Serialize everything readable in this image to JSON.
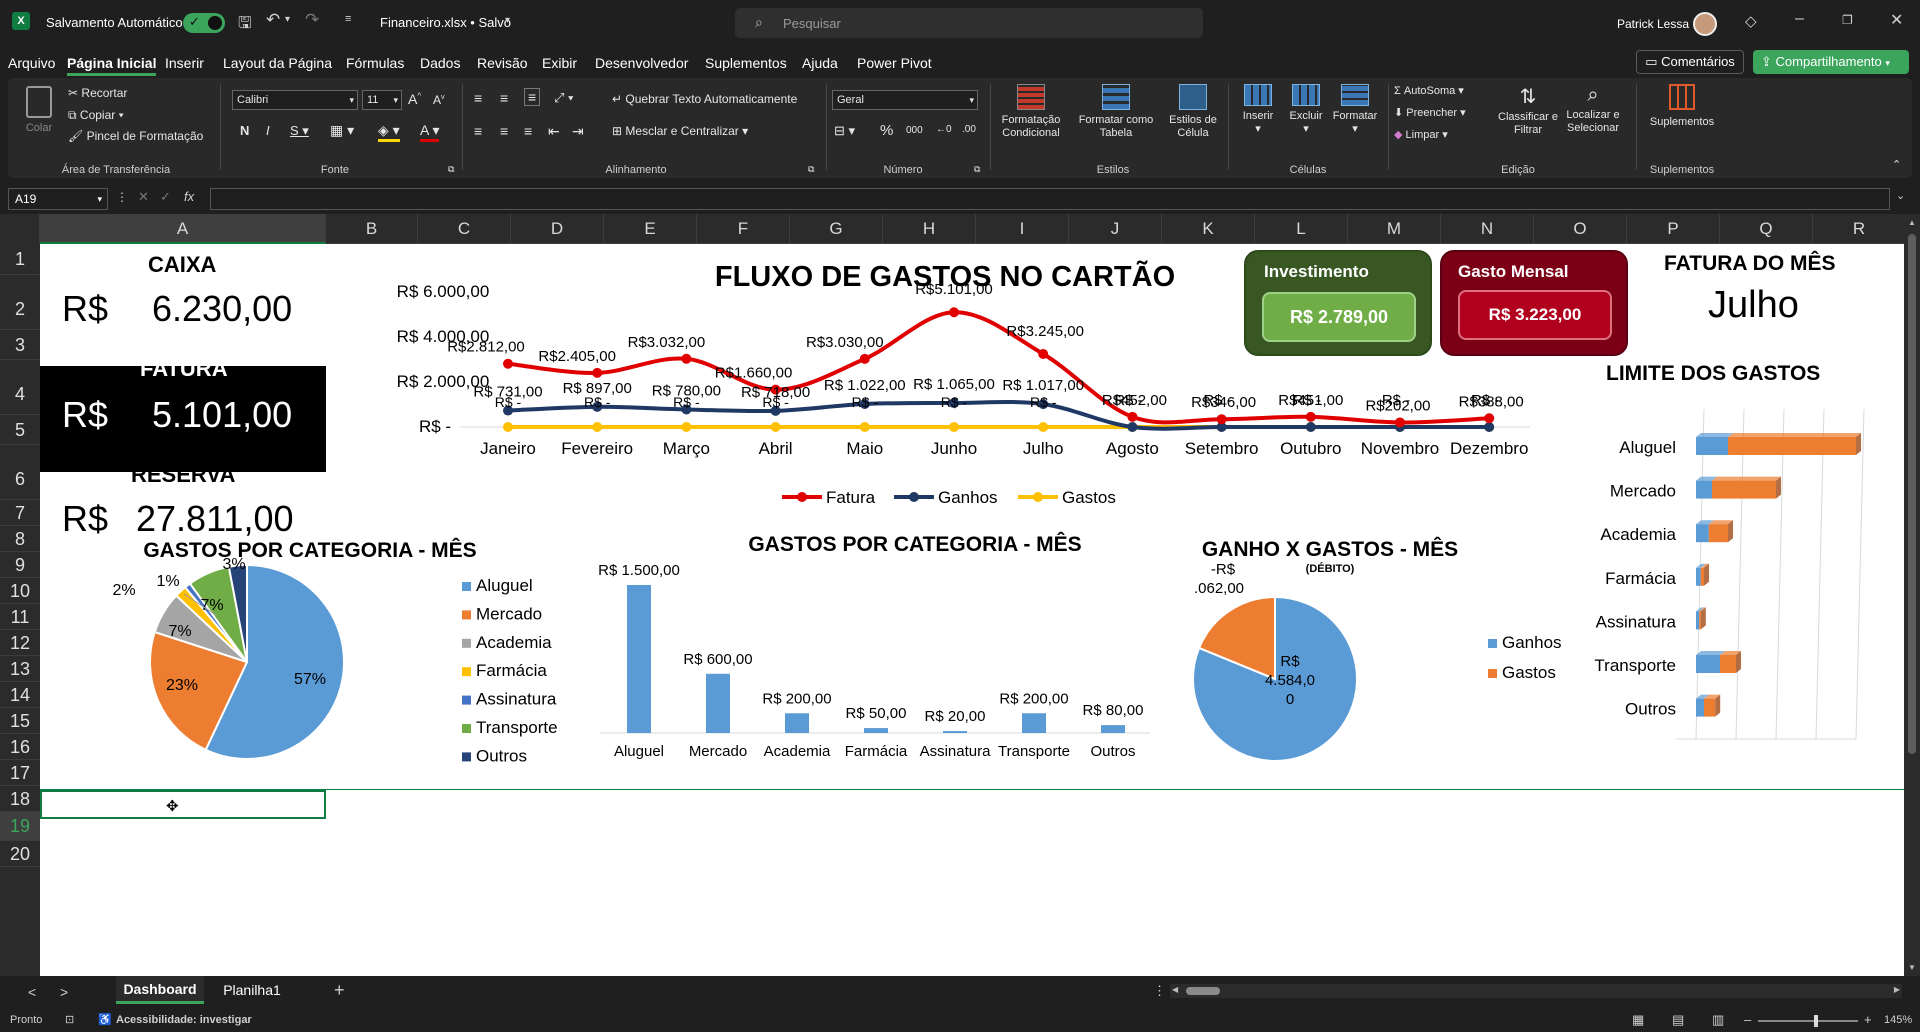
{
  "titlebar": {
    "autosave_label": "Salvamento Automático",
    "filename": "Financeiro.xlsx • Salvo",
    "search_placeholder": "Pesquisar",
    "user": "Patrick Lessa"
  },
  "menu": [
    "Arquivo",
    "Página Inicial",
    "Inserir",
    "Layout da Página",
    "Fórmulas",
    "Dados",
    "Revisão",
    "Exibir",
    "Desenvolvedor",
    "Suplementos",
    "Ajuda",
    "Power Pivot"
  ],
  "menu_right": {
    "comments": "Comentários",
    "share": "Compartilhamento"
  },
  "ribbon": {
    "clipboard": {
      "paste": "Colar",
      "cut": "Recortar",
      "copy": "Copiar",
      "format_painter": "Pincel de Formatação",
      "label": "Área de Transferência"
    },
    "font": {
      "name": "Calibri",
      "size": "11",
      "label": "Fonte"
    },
    "alignment": {
      "wrap": "Quebrar Texto Automaticamente",
      "merge": "Mesclar e Centralizar",
      "label": "Alinhamento"
    },
    "number": {
      "format": "Geral",
      "label": "Número"
    },
    "styles": {
      "cond": "Formatação Condicional",
      "table": "Formatar como Tabela",
      "cell": "Estilos de Célula",
      "label": "Estilos"
    },
    "cells": {
      "insert": "Inserir",
      "delete": "Excluir",
      "format": "Formatar",
      "label": "Células"
    },
    "editing": {
      "autosum": "AutoSoma",
      "fill": "Preencher",
      "clear": "Limpar",
      "sort": "Classificar e Filtrar",
      "find": "Localizar e Selecionar",
      "label": "Edição"
    },
    "addins": {
      "addins": "Suplementos",
      "label": "Suplementos"
    }
  },
  "formula": {
    "namebox": "A19",
    "fx": "fx"
  },
  "columns": [
    "A",
    "B",
    "C",
    "D",
    "E",
    "F",
    "G",
    "H",
    "I",
    "J",
    "K",
    "L",
    "M",
    "N",
    "O",
    "P",
    "Q",
    "R"
  ],
  "rows": [
    "1",
    "2",
    "3",
    "4",
    "5",
    "6",
    "7",
    "8",
    "9",
    "10",
    "11",
    "12",
    "13",
    "14",
    "15",
    "16",
    "17",
    "18",
    "19",
    "20"
  ],
  "dashboard": {
    "caixa_title": "CAIXA",
    "caixa_cur": "R$",
    "caixa_val": "6.230,00",
    "fatura_title": "FATURA",
    "fatura_cur": "R$",
    "fatura_val": "5.101,00",
    "reserva_title": "RESERVA",
    "reserva_cur": "R$",
    "reserva_val": "27.811,00",
    "investimento_title": "Investimento",
    "investimento_val": "R$ 2.789,00",
    "gasto_title": "Gasto Mensal",
    "gasto_val": "R$ 3.223,00",
    "fatura_mes_title": "FATURA DO MÊS",
    "fatura_mes_val": "Julho",
    "limite_title": "LIMITE DOS GASTOS",
    "ganho_title": "GANHO X GASTOS - MÊS",
    "ganho_sub": "(DÉBITO)",
    "colors": {
      "green_dark": "#385723",
      "green_light": "#70ad47",
      "red_dark": "#7b0016",
      "red_light": "#c00000"
    }
  },
  "chart_data": [
    {
      "type": "line",
      "title": "FLUXO DE GASTOS NO CARTÃO",
      "categories": [
        "Janeiro",
        "Fevereiro",
        "Março",
        "Abril",
        "Maio",
        "Junho",
        "Julho",
        "Agosto",
        "Setembro",
        "Outubro",
        "Novembro",
        "Dezembro"
      ],
      "yticks": [
        "R$ 6.000,00",
        "R$ 4.000,00",
        "R$ 2.000,00",
        "R$ -"
      ],
      "ylim": [
        0,
        6000
      ],
      "series": [
        {
          "name": "Fatura",
          "color": "#e00000",
          "values": [
            2812,
            2405,
            3032,
            1660,
            3030,
            5101,
            3245,
            452,
            346,
            451,
            202,
            388
          ],
          "labels": [
            "R$2.812,00",
            "R$2.405,00",
            "R$3.032,00",
            "R$1.660,00",
            "R$3.030,00",
            "R$5.101,00",
            "R$3.245,00",
            "R$452,00",
            "R$346,00",
            "R$451,00",
            "R$202,00",
            "R$388,00"
          ]
        },
        {
          "name": "Ganhos",
          "color": "#1f3864",
          "values": [
            731,
            897,
            780,
            718,
            1022,
            1065,
            1017,
            0,
            0,
            0,
            0,
            0
          ],
          "labels": [
            "R$ 731,00",
            "R$ 897,00",
            "R$ 780,00",
            "R$ 718,00",
            "R$ 1.022,00",
            "R$ 1.065,00",
            "R$ 1.017,00",
            "R$ -",
            "R$ -",
            "R$ -",
            "R$ -",
            "R$ -"
          ]
        },
        {
          "name": "Gastos",
          "color": "#ffc000",
          "values": [
            0,
            0,
            0,
            0,
            0,
            0,
            0,
            0,
            0,
            0,
            0,
            0
          ],
          "labels": [
            "R$ -",
            "R$ -",
            "R$ -",
            "R$ -",
            "R$ -",
            "R$ -",
            "R$ -",
            "R$ -",
            "R$ -",
            "R$ -",
            "R$ -",
            "R$ -"
          ]
        }
      ],
      "legend": "bottom"
    },
    {
      "type": "pie",
      "title": "GASTOS POR CATEGORIA - MÊS",
      "categories": [
        "Aluguel",
        "Mercado",
        "Academia",
        "Farmácia",
        "Assinatura",
        "Transporte",
        "Outros"
      ],
      "values": [
        57,
        23,
        7,
        2,
        1,
        7,
        3
      ],
      "labels": [
        "57%",
        "23%",
        "7%",
        "2%",
        "1%",
        "7%",
        "3%"
      ],
      "colors": [
        "#5b9bd5",
        "#ed7d31",
        "#a5a5a5",
        "#ffc000",
        "#4472c4",
        "#70ad47",
        "#264478"
      ],
      "legend": "right"
    },
    {
      "type": "bar",
      "title": "GASTOS POR CATEGORIA - MÊS",
      "categories": [
        "Aluguel",
        "Mercado",
        "Academia",
        "Farmácia",
        "Assinatura",
        "Transporte",
        "Outros"
      ],
      "values": [
        1500,
        600,
        200,
        50,
        20,
        200,
        80
      ],
      "labels": [
        "R$ 1.500,00",
        "R$ 600,00",
        "R$ 200,00",
        "R$ 50,00",
        "R$ 20,00",
        "R$ 200,00",
        "R$ 80,00"
      ],
      "color": "#5b9bd5"
    },
    {
      "type": "pie",
      "title": "GANHO X GASTOS - MÊS",
      "categories": [
        "Ganhos",
        "Gastos"
      ],
      "values": [
        4584,
        1062
      ],
      "labels": [
        "R$ 4.584,0 0",
        "-R$ .062,00"
      ],
      "colors": [
        "#5b9bd5",
        "#ed7d31"
      ],
      "legend": "right"
    },
    {
      "type": "bar",
      "title": "LIMITE DOS GASTOS",
      "orientation": "horizontal",
      "categories": [
        "Aluguel",
        "Mercado",
        "Academia",
        "Farmácia",
        "Assinatura",
        "Transporte",
        "Outros"
      ],
      "series": [
        {
          "color": "#5b9bd5",
          "values": [
            0.2,
            0.1,
            0.08,
            0.03,
            0.02,
            0.15,
            0.05
          ]
        },
        {
          "color": "#ed7d31",
          "values": [
            0.8,
            0.4,
            0.12,
            0.02,
            0.01,
            0.1,
            0.07
          ]
        }
      ]
    }
  ],
  "tabs": {
    "nav_prev": "<",
    "nav_next": ">",
    "sheets": [
      "Dashboard",
      "Planilha1"
    ],
    "add": "+"
  },
  "status": {
    "ready": "Pronto",
    "accessibility": "Acessibilidade: investigar",
    "zoom": "145%"
  }
}
